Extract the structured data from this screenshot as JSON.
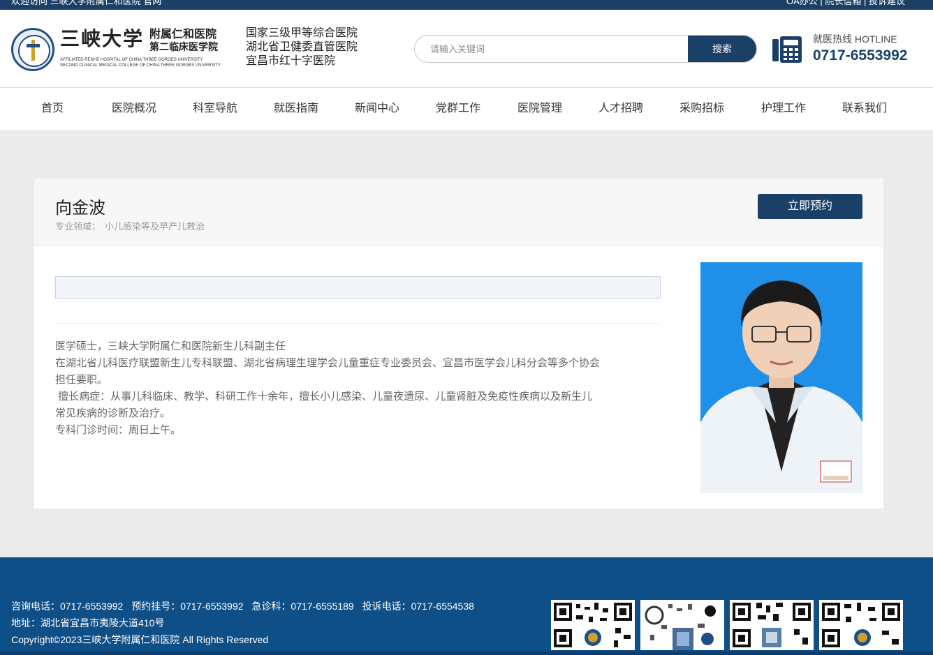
{
  "topbar": {
    "welcome": "欢迎访问 三峡大学附属仁和医院 官网",
    "links": "OA办公 | 院长信箱 | 投诉建议"
  },
  "header": {
    "logo_cn": "三峡大学",
    "logo_cn_sub1": "附属仁和医院",
    "logo_cn_sub2": "第二临床医学院",
    "logo_en1": "AFFILIATED RENHE HOSPITAL OF CHINA THREE GORGES UNIVERSITY",
    "logo_en2": "SECOND CLINICAL MEDICAL COLLEGE OF CHINA THREE GORGES UNIVERSITY",
    "badges": [
      "国家三级甲等综合医院",
      "湖北省卫健委直管医院",
      "宜昌市红十字医院"
    ],
    "search_placeholder": "请输入关键词",
    "search_button": "搜索",
    "hotline_label": "就医热线 HOTLINE",
    "hotline_number": "0717-6553992"
  },
  "nav": {
    "items": [
      "首页",
      "医院概况",
      "科室导航",
      "就医指南",
      "新闻中心",
      "党群工作",
      "医院管理",
      "人才招聘",
      "采购招标",
      "护理工作",
      "联系我们"
    ]
  },
  "doctor": {
    "name": "向金波",
    "specialty_label": "专业领域：",
    "specialty": "小儿感染等及早产儿救治",
    "book_button": "立即预约",
    "bio": [
      "医学硕士，三峡大学附属仁和医院新生儿科副主任",
      "在湖北省儿科医疗联盟新生儿专科联盟、湖北省病理生理学会儿童重症专业委员会、宜昌市医学会儿科分会等多个协会",
      "担任要职。",
      " 擅长病症：从事儿科临床、教学、科研工作十余年，擅长小儿感染、儿童夜遗尿、儿童肾脏及免疫性疾病以及新生儿",
      "常见疾病的诊断及治疗。",
      "专科门诊时间：周日上午。"
    ]
  },
  "footer": {
    "contact_line1": [
      "咨询电话：0717-6553992",
      "预约挂号：0717-6553992",
      "急诊科：0717-6555189",
      "投诉电话：0717-6554538"
    ],
    "address": "地址：湖北省宜昌市夷陵大道410号",
    "copyright": "Copyright©2023三峡大学附属仁和医院 All Rights Reserved"
  },
  "colors": {
    "brand": "#1b4068",
    "footer": "#0f4f88",
    "photo_bg": "#1f8fe8"
  }
}
